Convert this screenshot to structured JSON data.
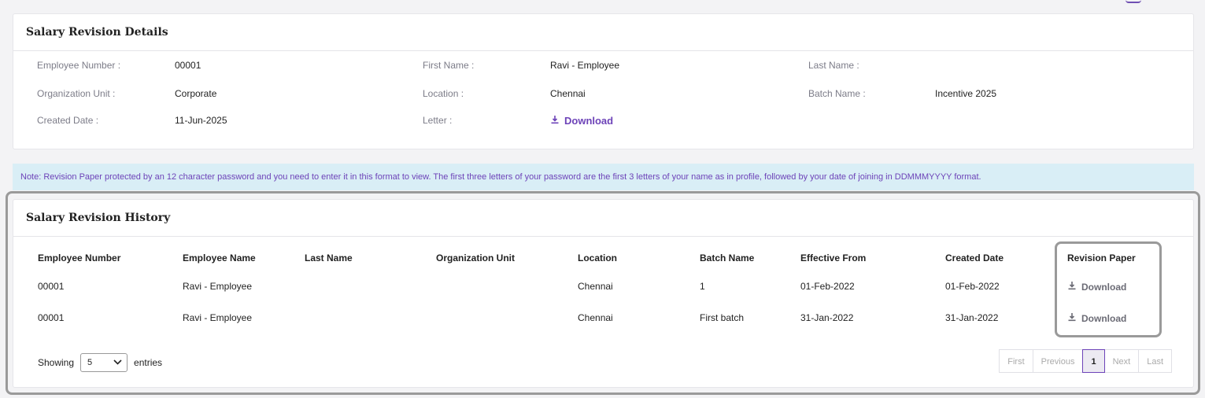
{
  "details": {
    "title": "Salary Revision Details",
    "rows": [
      [
        {
          "label": "Employee Number :",
          "value": "00001"
        },
        {
          "label": "First Name :",
          "value": "Ravi - Employee"
        },
        {
          "label": "Last Name :",
          "value": ""
        }
      ],
      [
        {
          "label": "Organization Unit :",
          "value": "Corporate"
        },
        {
          "label": "Location :",
          "value": "Chennai"
        },
        {
          "label": "Batch Name :",
          "value": "Incentive 2025"
        }
      ],
      [
        {
          "label": "Created Date :",
          "value": "11-Jun-2025"
        },
        {
          "label": "Letter :",
          "value": "Download"
        }
      ]
    ]
  },
  "note": "Note: Revision Paper protected by an 12 character password and you need to enter it in this format to view. The first three letters of your password are the first 3 letters of your name as in profile, followed by your date of joining in DDMMMYYYY format.",
  "history": {
    "title": "Salary Revision History",
    "columns": [
      "Employee Number",
      "Employee Name",
      "Last Name",
      "Organization Unit",
      "Location",
      "Batch Name",
      "Effective From",
      "Created Date",
      "Revision Paper"
    ],
    "rows": [
      [
        "00001",
        "Ravi - Employee",
        "",
        "",
        "Chennai",
        "1",
        "01-Feb-2022",
        "01-Feb-2022",
        "Download"
      ],
      [
        "00001",
        "Ravi - Employee",
        "",
        "",
        "Chennai",
        "First batch",
        "31-Jan-2022",
        "31-Jan-2022",
        "Download"
      ]
    ],
    "showing_label": "Showing",
    "page_size": "5",
    "entries_label": "entries",
    "pager": [
      "First",
      "Previous",
      "1",
      "Next",
      "Last"
    ]
  },
  "icons": {
    "download": "download-icon",
    "chevron": "chevron-down-icon"
  },
  "colors": {
    "accent": "#6d43b8",
    "note_bg": "#d9eef6"
  }
}
